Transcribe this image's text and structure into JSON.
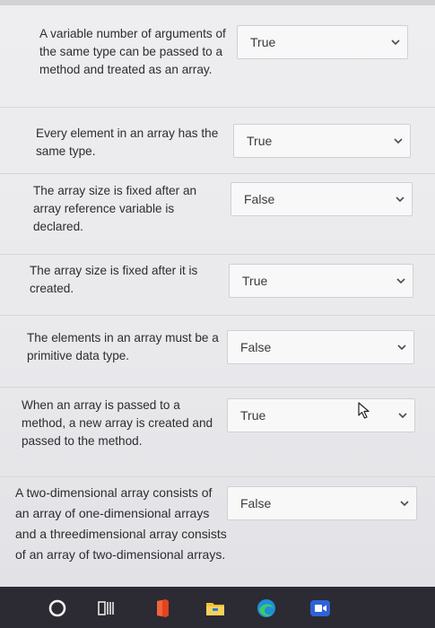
{
  "questions": [
    {
      "statement": "A variable number of arguments of the same type can be passed to a method and treated as an array.",
      "answer": "True"
    },
    {
      "statement": "Every element in an array has the same type.",
      "answer": "True"
    },
    {
      "statement": "The array size is fixed after an array reference variable is declared.",
      "answer": "False"
    },
    {
      "statement": "The array size is fixed after it is created.",
      "answer": "True"
    },
    {
      "statement": "The elements in an array must be a primitive data type.",
      "answer": "False"
    },
    {
      "statement": "When an array is passed to a method, a new array is created and passed to the method.",
      "answer": "True"
    },
    {
      "statement": "A two-dimensional array consists of an array of one-dimensional arrays and a threedimensional array consists of an array of two-dimensional arrays.",
      "answer": "False"
    }
  ],
  "taskbar": {
    "icons": [
      "search-circle-icon",
      "task-view-icon",
      "office-icon",
      "file-explorer-icon",
      "edge-browser-icon",
      "video-app-icon"
    ]
  },
  "colors": {
    "taskbar_bg": "#2c2a33",
    "chevron": "#4a4a55"
  }
}
